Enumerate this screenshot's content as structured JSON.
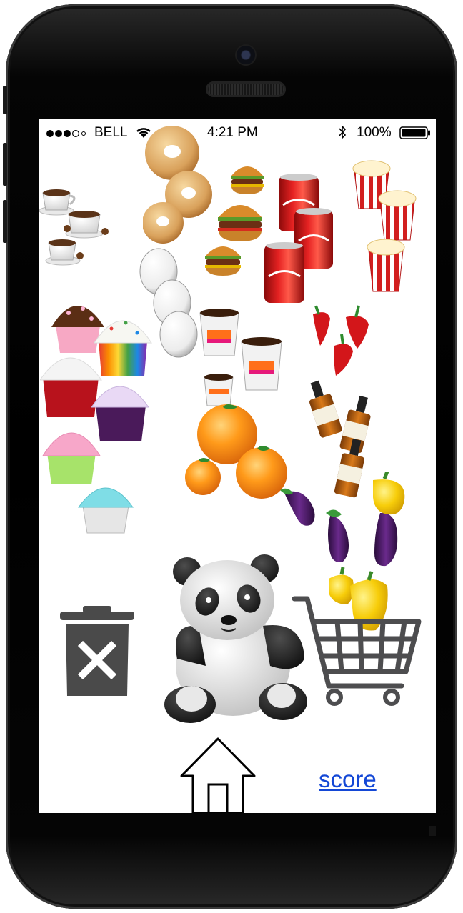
{
  "status_bar": {
    "carrier": "BELL",
    "time": "4:21 PM",
    "battery_percent": "100%",
    "icons": [
      "signal-dots-icon",
      "wifi-icon",
      "bluetooth-icon",
      "battery-icon"
    ]
  },
  "items": [
    {
      "name": "coffee-cups",
      "icon": "coffee-cup-icon",
      "count": 3
    },
    {
      "name": "donuts",
      "icon": "donut-icon",
      "count": 3
    },
    {
      "name": "hamburgers",
      "icon": "hamburger-icon",
      "count": 3
    },
    {
      "name": "cola-cans",
      "icon": "cola-can-icon",
      "count": 3
    },
    {
      "name": "popcorn",
      "icon": "popcorn-icon",
      "count": 3
    },
    {
      "name": "eggs",
      "icon": "egg-icon",
      "count": 3
    },
    {
      "name": "cupcakes",
      "icon": "cupcake-icon",
      "count": 6
    },
    {
      "name": "dunkin-cups",
      "icon": "dunkin-coffee-icon",
      "count": 3
    },
    {
      "name": "chili-peppers",
      "icon": "chili-pepper-icon",
      "count": 3
    },
    {
      "name": "whiskey-bottles",
      "icon": "whiskey-bottle-icon",
      "count": 3
    },
    {
      "name": "oranges",
      "icon": "orange-icon",
      "count": 3
    },
    {
      "name": "eggplants",
      "icon": "eggplant-icon",
      "count": 3
    },
    {
      "name": "yellow-peppers",
      "icon": "yellow-pepper-icon",
      "count": 3
    }
  ],
  "bottom": {
    "trash": "trash-can-icon",
    "mascot": "panda-icon",
    "cart": "shopping-cart-icon",
    "home": "home-icon",
    "score_label": "score"
  },
  "colors": {
    "link": "#1448d6",
    "trash": "#4a4a4a",
    "cart": "#4d4d4f"
  }
}
